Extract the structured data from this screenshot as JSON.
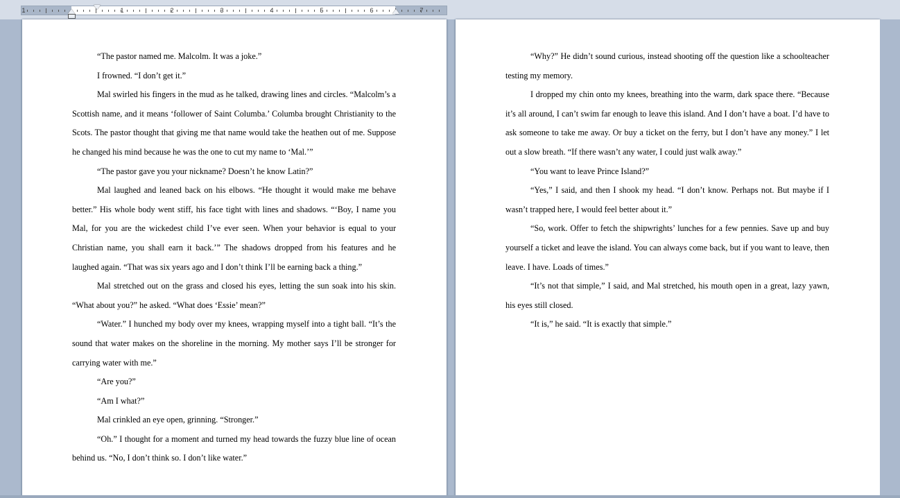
{
  "ruler": {
    "numbers": [
      "1",
      "1",
      "2",
      "3",
      "4",
      "5",
      "6",
      "7"
    ]
  },
  "page1": {
    "paragraphs": [
      {
        "indent": true,
        "text": "“The pastor named me. Malcolm. It was a joke.”"
      },
      {
        "indent": true,
        "text": "I frowned. “I don’t get it.”"
      },
      {
        "indent": true,
        "text": "Mal swirled his fingers in the mud as he talked, drawing lines and circles. “Malcolm’s a Scottish name, and it means ‘follower of Saint Columba.’ Columba brought Christianity to the Scots. The pastor thought that giving me that name would take the heathen out of me. Suppose he changed his mind because he was the one to cut my name to ‘Mal.’”"
      },
      {
        "indent": true,
        "text": "“The pastor gave you your nickname? Doesn’t he know Latin?”"
      },
      {
        "indent": true,
        "text": "Mal laughed and leaned back on his elbows. “He thought it would make me behave better.” His whole body went stiff, his face tight with lines and shadows. “‘Boy, I name you Mal, for you are the wickedest child I’ve ever seen. When your behavior is equal to your Christian name, you shall earn it back.’” The shadows dropped from his features and he laughed again. “That was six years ago and I don’t think I’ll be earning back a thing.”"
      },
      {
        "indent": true,
        "text": "Mal stretched out on the grass and closed his eyes, letting the sun soak into his skin. “What about you?” he asked. “What does ‘Essie’ mean?”"
      },
      {
        "indent": true,
        "text": "“Water.” I hunched my body over my knees, wrapping myself into a tight ball. “It’s the sound that water makes on the shoreline in the morning. My mother says I’ll be stronger for carrying water with me.”"
      },
      {
        "indent": true,
        "text": "“Are you?”"
      },
      {
        "indent": true,
        "text": "“Am I what?”"
      },
      {
        "indent": true,
        "text": "Mal crinkled an eye open, grinning. “Stronger.”"
      },
      {
        "indent": true,
        "text": "“Oh.” I thought for a moment and turned my head towards the fuzzy blue line of ocean behind us. “No, I don’t think so. I don’t like water.”"
      }
    ]
  },
  "page2": {
    "paragraphs": [
      {
        "indent": true,
        "text": "“Why?” He didn’t sound curious, instead shooting off the question like a schoolteacher testing my memory."
      },
      {
        "indent": true,
        "text": "I dropped my chin onto my knees, breathing into the warm, dark space there. “Because it’s all around, I can’t swim far enough to leave this island. And I don’t have a boat. I’d have to ask someone to take me away. Or buy a ticket on the ferry, but I don’t have any money.” I let out a slow breath. “If there wasn’t any water, I could just walk away.”"
      },
      {
        "indent": true,
        "text": "“You want to leave Prince Island?”"
      },
      {
        "indent": true,
        "text": "“Yes,” I said, and then I shook my head. “I don’t know. Perhaps not. But maybe if I wasn’t trapped here, I would feel better about it.”"
      },
      {
        "indent": true,
        "text": "“So, work. Offer to fetch the shipwrights’ lunches for a few pennies. Save up and buy yourself a ticket and leave the island. You can always come back, but if you want to leave, then leave. I have. Loads of times.”"
      },
      {
        "indent": true,
        "text": "“It’s not that simple,” I said, and Mal stretched, his mouth open in a great, lazy yawn, his eyes still closed."
      },
      {
        "indent": true,
        "text": "“It is,” he said. “It is exactly that simple.”"
      }
    ]
  }
}
